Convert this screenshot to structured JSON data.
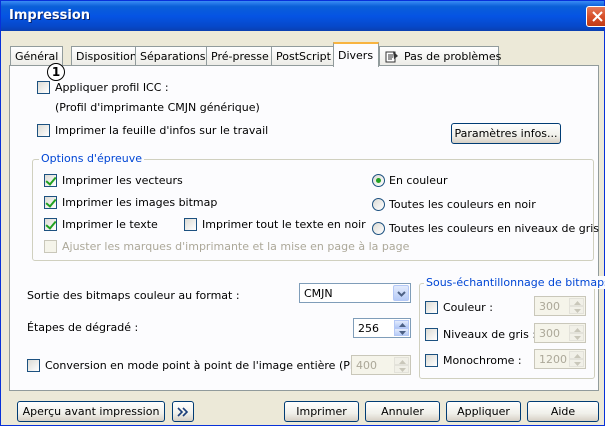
{
  "window": {
    "title": "Impression"
  },
  "tabs": [
    {
      "label": "Général"
    },
    {
      "label": "Disposition"
    },
    {
      "label": "Séparations"
    },
    {
      "label": "Pré-presse"
    },
    {
      "label": "PostScript"
    },
    {
      "label": "Divers"
    },
    {
      "label": "Pas de problèmes"
    }
  ],
  "badge": "1",
  "icc": {
    "label": "Appliquer profil ICC :",
    "profile": "(Profil d'imprimante CMJN générique)",
    "checked": false
  },
  "job_info": {
    "label": "Imprimer la feuille d'infos sur le travail",
    "checked": false,
    "button": "Paramètres infos..."
  },
  "proof": {
    "title": "Options d'épreuve",
    "vectors": "Imprimer les vecteurs",
    "bitmaps": "Imprimer les images bitmap",
    "text": "Imprimer le texte",
    "all_text_black": "Imprimer tout le texte en noir",
    "adjust_marks": "Ajuster les marques d'imprimante et la mise en page à la page",
    "color": "En couleur",
    "all_black": "Toutes les couleurs en noir",
    "grayscale": "Toutes les couleurs en niveaux de gris"
  },
  "bitmap_output": {
    "label": "Sortie des bitmaps couleur au format :",
    "value": "CMJN"
  },
  "gradient_steps": {
    "label": "Étapes de dégradé :",
    "value": "256"
  },
  "ppp": {
    "label": "Conversion en mode point à point de l'image entière (PPP) :",
    "value": "400"
  },
  "downsample": {
    "title": "Sous-échantillonnage de bitmaps",
    "color": {
      "label": "Couleur :",
      "value": "300"
    },
    "gray": {
      "label": "Niveaux de gris :",
      "value": "300"
    },
    "mono": {
      "label": "Monochrome :",
      "value": "1200"
    }
  },
  "buttons": {
    "preview": "Aperçu avant impression",
    "print": "Imprimer",
    "cancel": "Annuler",
    "apply": "Appliquer",
    "help": "Aide"
  },
  "colors": {
    "title_bar": "#0554e3",
    "group_title": "#0046d5",
    "check": "#21a121"
  }
}
